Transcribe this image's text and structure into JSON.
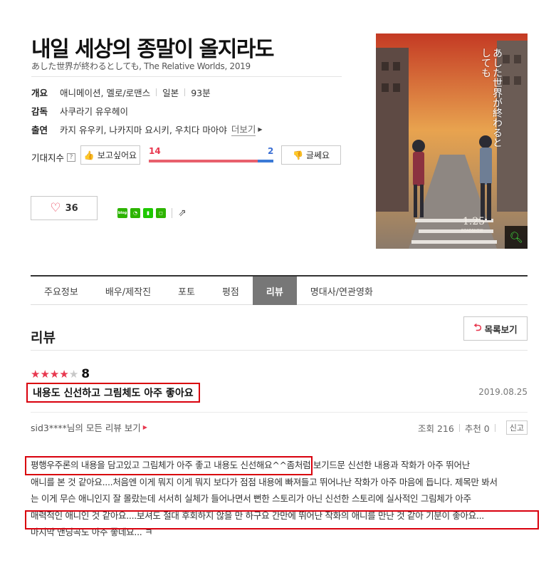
{
  "movie": {
    "title": "내일 세상의 종말이 올지라도",
    "subtitle": "あした世界が終わるとしても, The Relative Worlds, 2019",
    "overview_label": "개요",
    "genre": "애니메이션, 멜로/로맨스",
    "country": "일본",
    "runtime": "93분",
    "director_label": "감독",
    "director": "사쿠라기 유우헤이",
    "cast_label": "출연",
    "cast": "카지 유우키, 나카지마 요시키, 우치다 마아야",
    "more_label": "더보기",
    "expect_label": "기대지수",
    "want_label": "보고싶어요",
    "nope_label": "글쎄요",
    "want_count": "14",
    "nope_count": "2",
    "want_fraction": 0.875,
    "like_count": "36"
  },
  "poster": {
    "title_jp": "あした世界が終わるとしても",
    "date": "1.25",
    "date_caption": "ROADSHOW"
  },
  "share": {
    "icons": [
      "blog-icon",
      "band-icon",
      "bookmark-icon",
      "cafe-icon",
      "share-icon"
    ]
  },
  "tabs": [
    {
      "label": "주요정보"
    },
    {
      "label": "배우/제작진"
    },
    {
      "label": "포토"
    },
    {
      "label": "평점"
    },
    {
      "label": "리뷰"
    },
    {
      "label": "명대사/연관영화"
    }
  ],
  "active_tab": "리뷰",
  "reviews_section": {
    "title": "리뷰",
    "list_button": "목록보기"
  },
  "review": {
    "rating_stars": 4,
    "score": "8",
    "title": "내용도 신선하고 그림체도 아주 좋아요",
    "date": "2019.08.25",
    "author": "sid3****님의 모든 리뷰 보기",
    "views": "조회 216",
    "recommend": "추천 0",
    "report": "신고",
    "body_lines": [
      "평행우주론의 내용을 담고있고 그림체가 아주 좋고 내용도 신선해요^^좀처럼 보기드문 신선한 내용과 작화가 아주 뛰어난",
      "애니를 본 것 같아요....처음엔 이게 뭐지 이게 뭐지 보다가 점점 내용에 빠져들고 뛰어나난 작화가 아주 마음에 듭니다. 제목만 봐서",
      "는 이게 무슨 애니인지 잘 몰랐는데 서서히 실체가 들어나면서 뻔한 스토리가 아닌 신선한 스토리에 실사적인 그림체가 아주",
      "매력적인 애니인 것 같아요....보셔도 절대 후회하지 않을 만 하구요 간만에 뛰어난 작화의 애니를 만난 것 같아 기분이 좋아요...",
      "마지막 앤딩곡도 아주 좋네요... ㅋ"
    ]
  },
  "colors": {
    "accent_red": "#e8384f",
    "accent_blue": "#3b7ad6",
    "highlight_box": "#d9000d",
    "naver_green": "#2db400"
  }
}
